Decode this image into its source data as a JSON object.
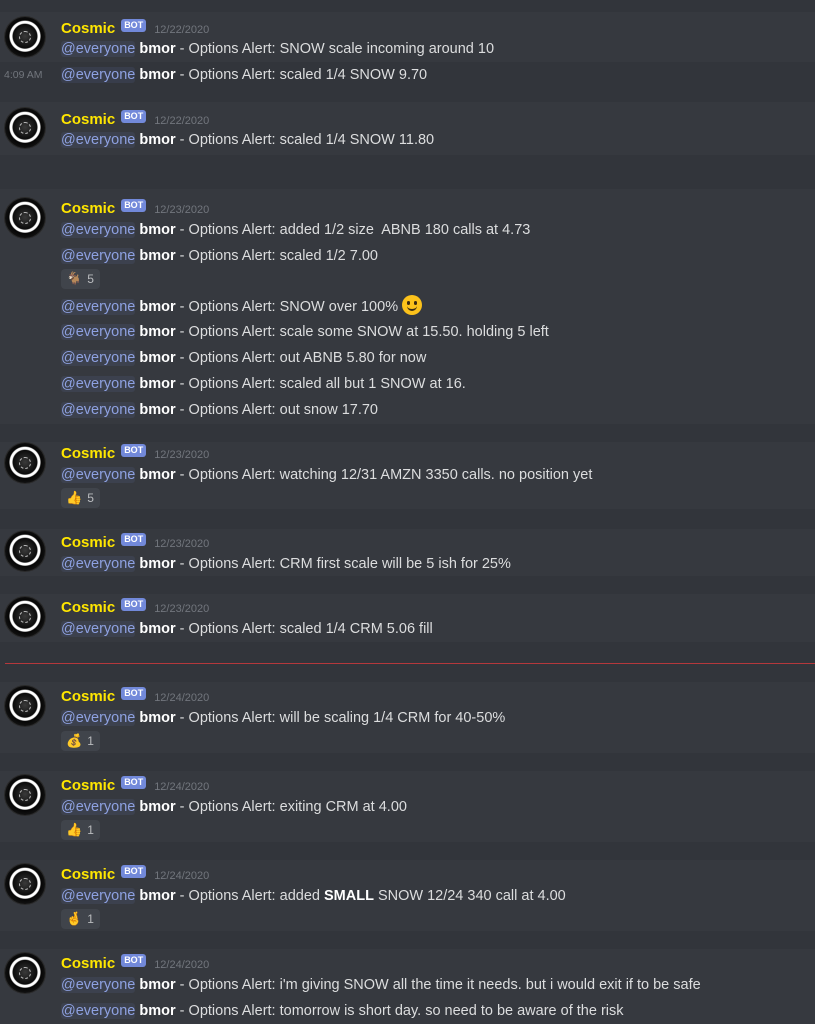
{
  "author": "Cosmic",
  "bot_badge": "BOT",
  "mention": "@everyone",
  "sender": "bmor",
  "prefix": " - Options Alert: ",
  "side_timestamp": "4:09 AM",
  "dates": {
    "d1": "12/22/2020",
    "d2": "12/22/2020",
    "d3": "12/23/2020",
    "d4": "12/23/2020",
    "d5": "12/23/2020",
    "d6": "12/23/2020",
    "d7": "12/24/2020",
    "d8": "12/24/2020",
    "d9": "12/24/2020",
    "d10": "12/24/2020"
  },
  "messages": {
    "m1": "SNOW scale incoming around 10",
    "m2": "scaled 1/4 SNOW 9.70",
    "m3": "scaled 1/4 SNOW 11.80",
    "m4": "added 1/2 size  ABNB 180 calls at 4.73",
    "m5": "scaled 1/2 7.00",
    "m6": "SNOW over 100%",
    "m7": "scale some SNOW at 15.50. holding 5 left",
    "m8": "out ABNB 5.80 for now",
    "m9": "scaled all but 1 SNOW at 16.",
    "m10": "out snow 17.70",
    "m11": "watching 12/31 AMZN 3350 calls. no position yet",
    "m12": "CRM first scale will be 5 ish for 25%",
    "m13": "scaled 1/4 CRM 5.06 fill",
    "m14": "will be scaling 1/4 CRM for 40-50%",
    "m15": "exiting CRM at 4.00",
    "m16a": "added ",
    "m16b": "SMALL",
    "m16c": " SNOW 12/24 340 call at 4.00",
    "m17": "i'm giving SNOW all the time it needs. but i would exit if to be safe",
    "m18": "tomorrow is short day. so need to be aware of the risk"
  },
  "reactions": {
    "r1": {
      "emoji": "🐐",
      "count": "5"
    },
    "r2": {
      "emoji": "👍",
      "count": "5"
    },
    "r3": {
      "emoji": "💰",
      "count": "1"
    },
    "r4": {
      "emoji": "👍",
      "count": "1"
    },
    "r5": {
      "emoji": "🤞",
      "count": "1"
    }
  },
  "colors": {
    "background": "#36393f",
    "author": "#ffe600",
    "mention": "#8ea1e1",
    "bot_badge": "#7289da",
    "new_messages_line": "#b5383c"
  }
}
